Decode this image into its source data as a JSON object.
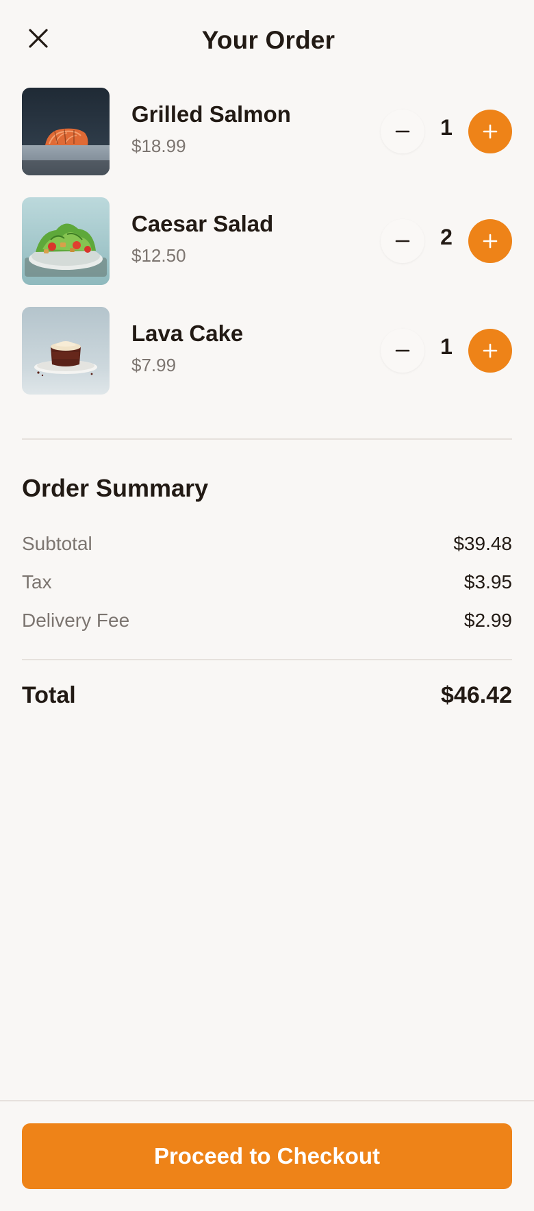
{
  "header": {
    "title": "Your Order",
    "close_icon": "close-icon"
  },
  "items": [
    {
      "name": "Grilled Salmon",
      "price": "$18.99",
      "quantity": "1"
    },
    {
      "name": "Caesar Salad",
      "price": "$12.50",
      "quantity": "2"
    },
    {
      "name": "Lava Cake",
      "price": "$7.99",
      "quantity": "1"
    }
  ],
  "summary": {
    "title": "Order Summary",
    "rows": [
      {
        "label": "Subtotal",
        "value": "$39.48"
      },
      {
        "label": "Tax",
        "value": "$3.95"
      },
      {
        "label": "Delivery Fee",
        "value": "$2.99"
      }
    ],
    "total_label": "Total",
    "total_value": "$46.42"
  },
  "footer": {
    "checkout_label": "Proceed to Checkout"
  },
  "colors": {
    "accent": "#ee8318",
    "background": "#f9f7f5",
    "text": "#221a14",
    "muted": "#7c7570"
  }
}
